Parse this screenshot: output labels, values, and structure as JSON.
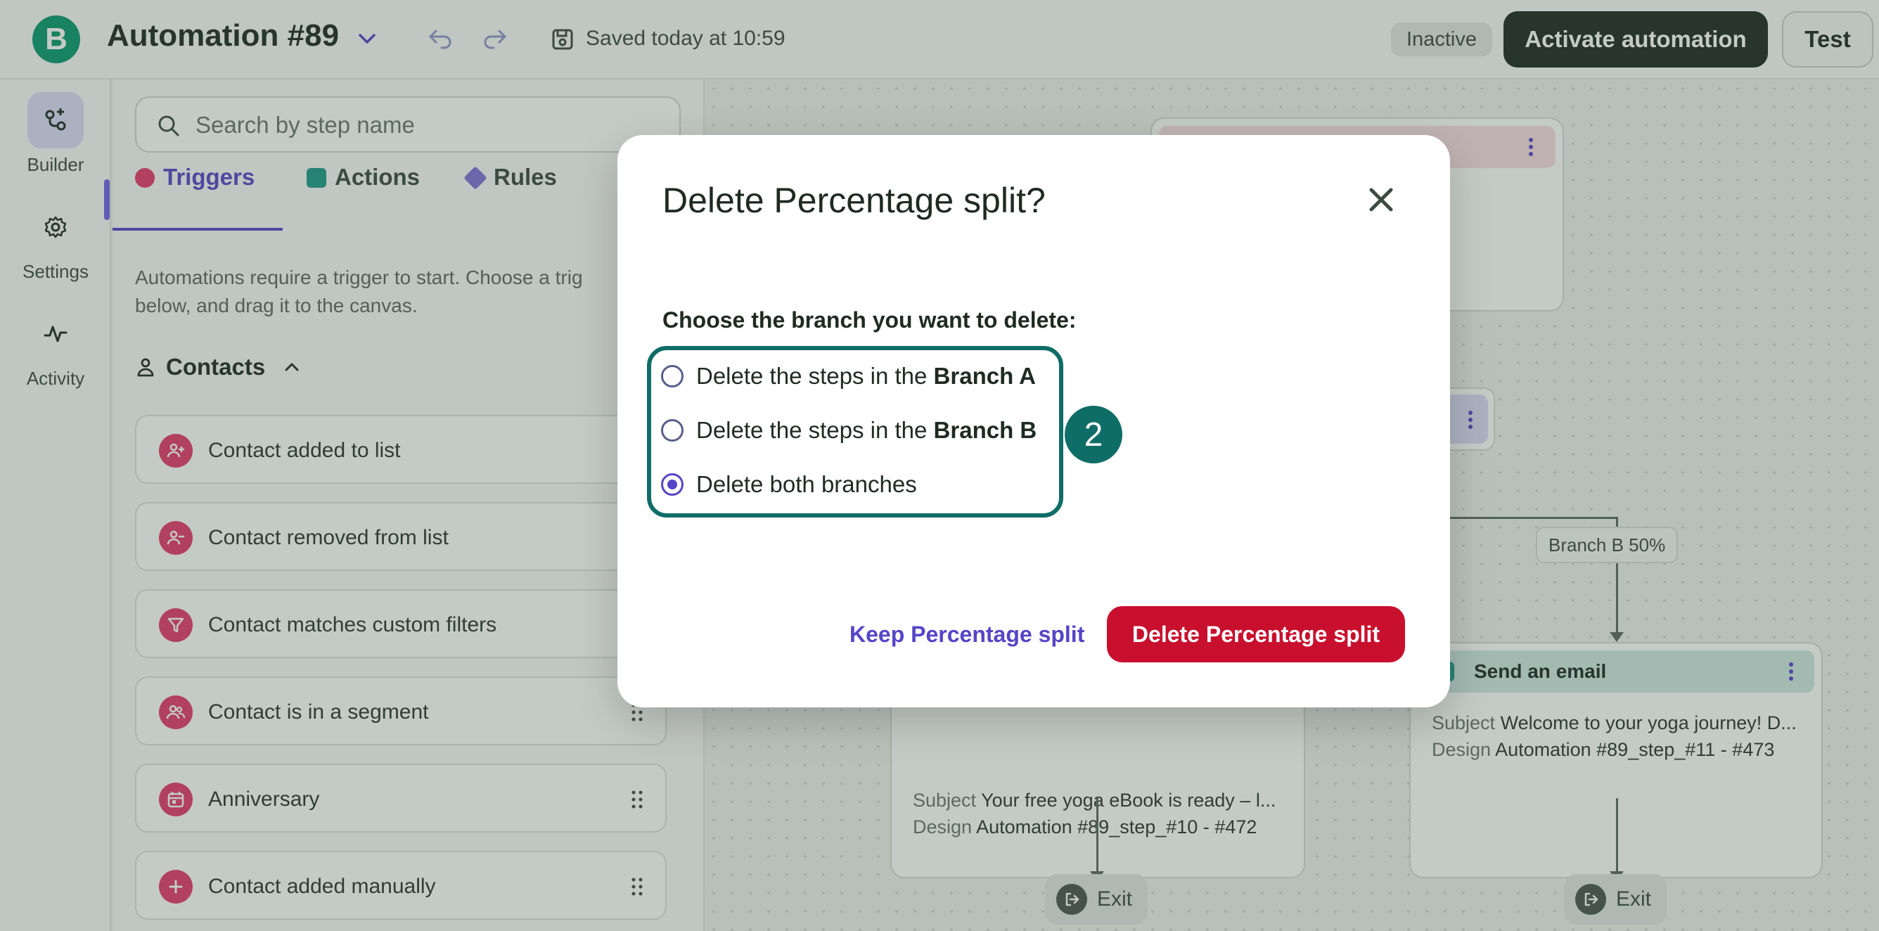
{
  "topbar": {
    "logo_letter": "B",
    "title": "Automation #89",
    "saved_status": "Saved today at 10:59",
    "status_badge": "Inactive",
    "activate_label": "Activate automation",
    "test_label": "Test"
  },
  "leftnav": {
    "items": [
      {
        "label": "Builder",
        "icon": "builder-icon",
        "active": true
      },
      {
        "label": "Settings",
        "icon": "gear-icon",
        "active": false
      },
      {
        "label": "Activity",
        "icon": "activity-icon",
        "active": false
      }
    ]
  },
  "sidebar": {
    "search_placeholder": "Search by step name",
    "tabs": [
      {
        "label": "Triggers",
        "color": "#e43c6b",
        "active": true
      },
      {
        "label": "Actions",
        "color": "#1f9a8a",
        "active": false
      },
      {
        "label": "Rules",
        "color": "#7f72d9",
        "active": false
      }
    ],
    "help_line1": "Automations require a trigger to start. Choose a trig",
    "help_line2": "below, and drag it to the canvas.",
    "group_title": "Contacts",
    "triggers": [
      {
        "label": "Contact added to list",
        "icon": "user-plus-icon"
      },
      {
        "label": "Contact removed from list",
        "icon": "user-minus-icon"
      },
      {
        "label": "Contact matches custom filters",
        "icon": "filter-icon"
      },
      {
        "label": "Contact is in a segment",
        "icon": "users-icon"
      },
      {
        "label": "Anniversary",
        "icon": "calendar-icon"
      },
      {
        "label": "Contact added manually",
        "icon": "plus-icon"
      }
    ]
  },
  "canvas": {
    "branch_b_label": "Branch B 50%",
    "email_node_a": {
      "subject_key": "Subject",
      "subject": "Your free yoga eBook is ready – l...",
      "design_key": "Design",
      "design": "Automation #89_step_#10 - #472"
    },
    "email_node_b": {
      "title": "Send an email",
      "subject_key": "Subject",
      "subject": "Welcome to your yoga journey! D...",
      "design_key": "Design",
      "design": "Automation #89_step_#11 - #473"
    },
    "exit_label": "Exit"
  },
  "modal": {
    "title": "Delete Percentage split?",
    "subtitle": "Choose the branch you want to delete:",
    "options": [
      {
        "prefix": "Delete the steps in the ",
        "bold": "Branch A",
        "checked": false
      },
      {
        "prefix": "Delete the steps in the ",
        "bold": "Branch B",
        "checked": false
      },
      {
        "prefix": "Delete both branches",
        "bold": "",
        "checked": true
      }
    ],
    "step_badge": "2",
    "keep_label": "Keep Percentage split",
    "delete_label": "Delete Percentage split"
  },
  "colors": {
    "brand_green": "#0b996e",
    "accent_purple": "#5545c8",
    "danger_red": "#c8102e",
    "highlight_teal": "#0f6d67"
  }
}
